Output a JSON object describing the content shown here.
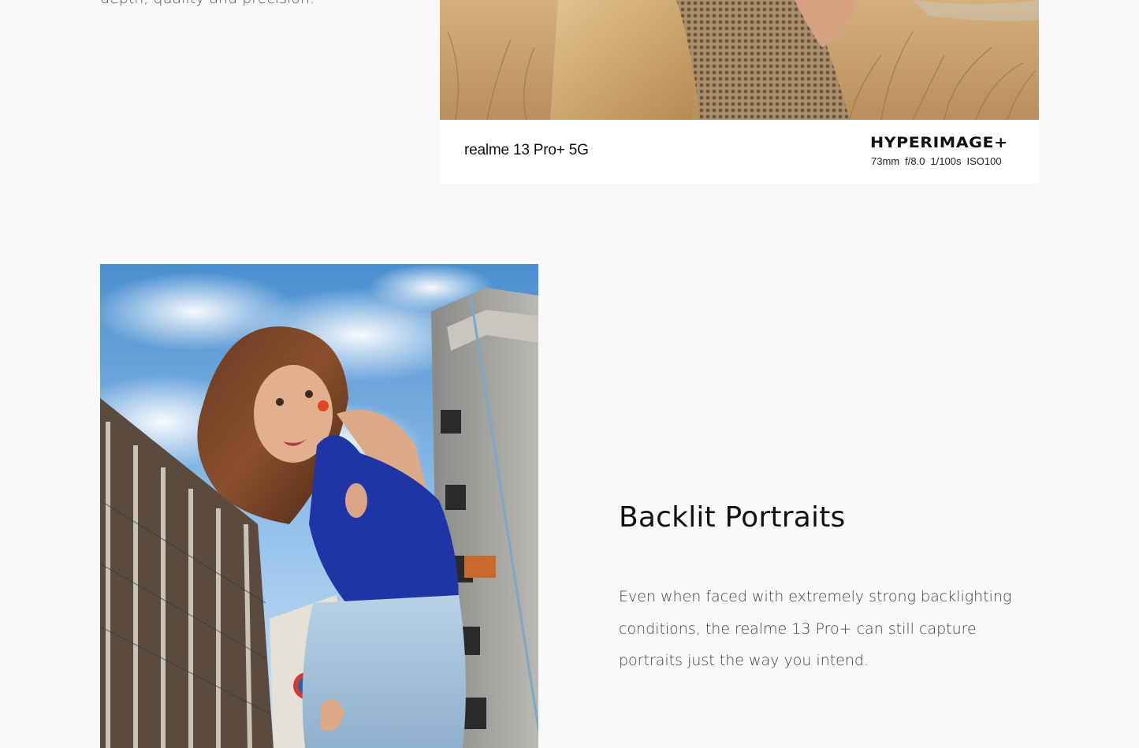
{
  "top_section": {
    "description_tail": "depth, quality and precision.",
    "photo_watermark": {
      "device": "realme 13 Pro+ 5G",
      "brand": "HYPERIMAGE+",
      "exif": [
        "73mm",
        "f/8.0",
        "1/100s",
        "ISO100"
      ]
    }
  },
  "feature": {
    "title": "Backlit Portraits",
    "description": "Even when faced with extremely strong backlighting conditions, the realme 13 Pro+ can still capture portraits just the way you intend."
  },
  "colors": {
    "page_background": "#f8f8f8",
    "title_text": "#111111",
    "body_text": "#444444"
  }
}
